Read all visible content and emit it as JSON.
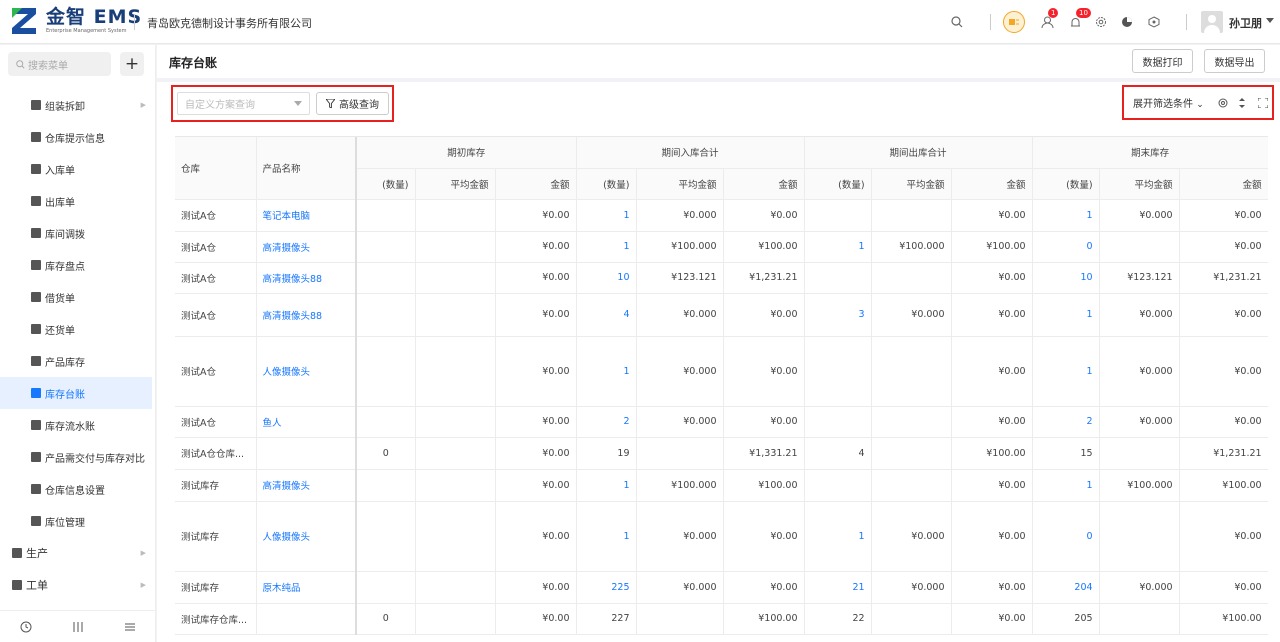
{
  "app": {
    "logo_text": "金智 EMS",
    "logo_sub": "Enterprise Management System",
    "company": "青岛欧克德制设计事务所有限公司"
  },
  "header": {
    "badge_1": "1",
    "badge_2": "10",
    "username": "孙卫朋"
  },
  "colors": {
    "accent": "#1677ff",
    "highlight": "#e8211f",
    "badge": "#f5222d"
  },
  "sidebar": {
    "search_placeholder": "搜索菜单",
    "items": [
      {
        "label": "组装拆卸",
        "icon": "box-icon",
        "has_children": true
      },
      {
        "label": "仓库提示信息",
        "icon": "info-icon"
      },
      {
        "label": "入库单",
        "icon": "inbound-icon"
      },
      {
        "label": "出库单",
        "icon": "outbound-icon"
      },
      {
        "label": "库间调拨",
        "icon": "transfer-icon"
      },
      {
        "label": "库存盘点",
        "icon": "inventory-check-icon"
      },
      {
        "label": "借货单",
        "icon": "borrow-icon"
      },
      {
        "label": "还货单",
        "icon": "return-icon"
      },
      {
        "label": "产品库存",
        "icon": "document-icon"
      },
      {
        "label": "库存台账",
        "icon": "ledger-icon",
        "active": true
      },
      {
        "label": "库存流水账",
        "icon": "flow-icon"
      },
      {
        "label": "产品需交付与库存对比",
        "icon": "compare-icon"
      },
      {
        "label": "仓库信息设置",
        "icon": "settings-icon"
      },
      {
        "label": "库位管理",
        "icon": "grid-icon"
      }
    ],
    "top_items": [
      {
        "label": "生产",
        "icon": "production-icon"
      },
      {
        "label": "工单",
        "icon": "workorder-icon"
      }
    ]
  },
  "page": {
    "title": "库存台账",
    "print_label": "数据打印",
    "export_label": "数据导出"
  },
  "filter": {
    "scheme_placeholder": "自定义方案查询",
    "advanced_label": "高级查询",
    "expand_label": "展开筛选条件"
  },
  "table": {
    "fixed_headers": [
      "仓库",
      "产品名称"
    ],
    "groups": [
      "期初库存",
      "期间入库合计",
      "期间出库合计",
      "期末库存"
    ],
    "sub_headers": [
      "(数量)",
      "平均金额",
      "金额"
    ],
    "rows": [
      [
        "测试A仓",
        "笔记本电脑",
        "",
        "",
        "¥0.00",
        "1",
        "¥0.000",
        "¥0.00",
        "",
        "",
        "¥0.00",
        "1",
        "¥0.000",
        "¥0.00"
      ],
      [
        "测试A仓",
        "高清摄像头",
        "",
        "",
        "¥0.00",
        "1",
        "¥100.000",
        "¥100.00",
        "1",
        "¥100.000",
        "¥100.00",
        "0",
        "",
        "¥0.00"
      ],
      [
        "测试A仓",
        "高清摄像头88",
        "",
        "",
        "¥0.00",
        "10",
        "¥123.121",
        "¥1,231.21",
        "",
        "",
        "¥0.00",
        "10",
        "¥123.121",
        "¥1,231.21"
      ],
      [
        "测试A仓",
        "高清摄像头88",
        "",
        "",
        "¥0.00",
        "4",
        "¥0.000",
        "¥0.00",
        "3",
        "¥0.000",
        "¥0.00",
        "1",
        "¥0.000",
        "¥0.00"
      ],
      [
        "测试A仓",
        "人像摄像头",
        "",
        "",
        "¥0.00",
        "1",
        "¥0.000",
        "¥0.00",
        "",
        "",
        "¥0.00",
        "1",
        "¥0.000",
        "¥0.00"
      ],
      [
        "测试A仓",
        "鱼人",
        "",
        "",
        "¥0.00",
        "2",
        "¥0.000",
        "¥0.00",
        "",
        "",
        "¥0.00",
        "2",
        "¥0.000",
        "¥0.00"
      ],
      [
        "测试A仓仓库...",
        "",
        "0",
        "",
        "¥0.00",
        "19",
        "",
        "¥1,331.21",
        "4",
        "",
        "¥100.00",
        "15",
        "",
        "¥1,231.21"
      ],
      [
        "测试库存",
        "高清摄像头",
        "",
        "",
        "¥0.00",
        "1",
        "¥100.000",
        "¥100.00",
        "",
        "",
        "¥0.00",
        "1",
        "¥100.000",
        "¥100.00"
      ],
      [
        "测试库存",
        "人像摄像头",
        "",
        "",
        "¥0.00",
        "1",
        "¥0.000",
        "¥0.00",
        "1",
        "¥0.000",
        "¥0.00",
        "0",
        "",
        "¥0.00"
      ],
      [
        "测试库存",
        "原木纯品",
        "",
        "",
        "¥0.00",
        "225",
        "¥0.000",
        "¥0.00",
        "21",
        "¥0.000",
        "¥0.00",
        "204",
        "¥0.000",
        "¥0.00"
      ],
      [
        "测试库存仓库...",
        "",
        "0",
        "",
        "¥0.00",
        "227",
        "",
        "¥100.00",
        "22",
        "",
        "¥0.00",
        "205",
        "",
        "¥100.00"
      ]
    ]
  }
}
